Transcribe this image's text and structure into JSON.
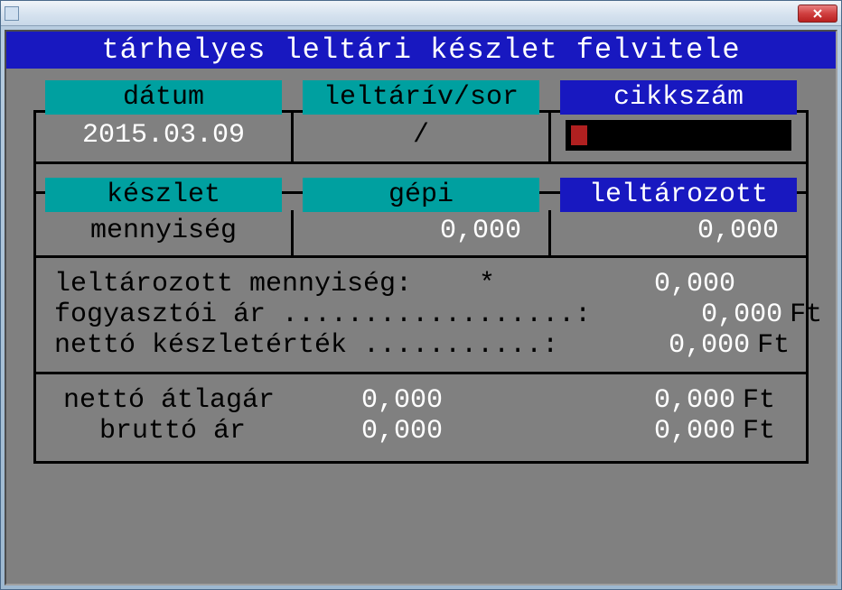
{
  "title": "tárhelyes leltári készlet felvitele",
  "row1": {
    "datum_label": "dátum",
    "datum_value": "2015.03.09",
    "leltariv_label": "leltárív/sor",
    "leltariv_value": "/",
    "cikkszam_label": "cikkszám"
  },
  "row3": {
    "keszlet_label": "készlet",
    "keszlet_sublabel": "mennyiség",
    "gepi_label": "gépi",
    "gepi_value": "0,000",
    "leltarozott_label": "leltározott",
    "leltarozott_value": "0,000"
  },
  "row4": {
    "l1_label": "leltározott mennyiség:",
    "l1_mid": "*",
    "l1_value": "0,000",
    "l2_label": "fogyasztói ár ..................:",
    "l2_value": "0,000",
    "l3_label": "nettó készletérték ...........:",
    "l3_value": "0,000",
    "unit": "Ft"
  },
  "row5": {
    "l1_label": "nettó átlagár",
    "l1_v1": "0,000",
    "l1_v2": "0,000",
    "l2_label": "bruttó ár",
    "l2_v1": "0,000",
    "l2_v2": "0,000",
    "unit": "Ft"
  }
}
